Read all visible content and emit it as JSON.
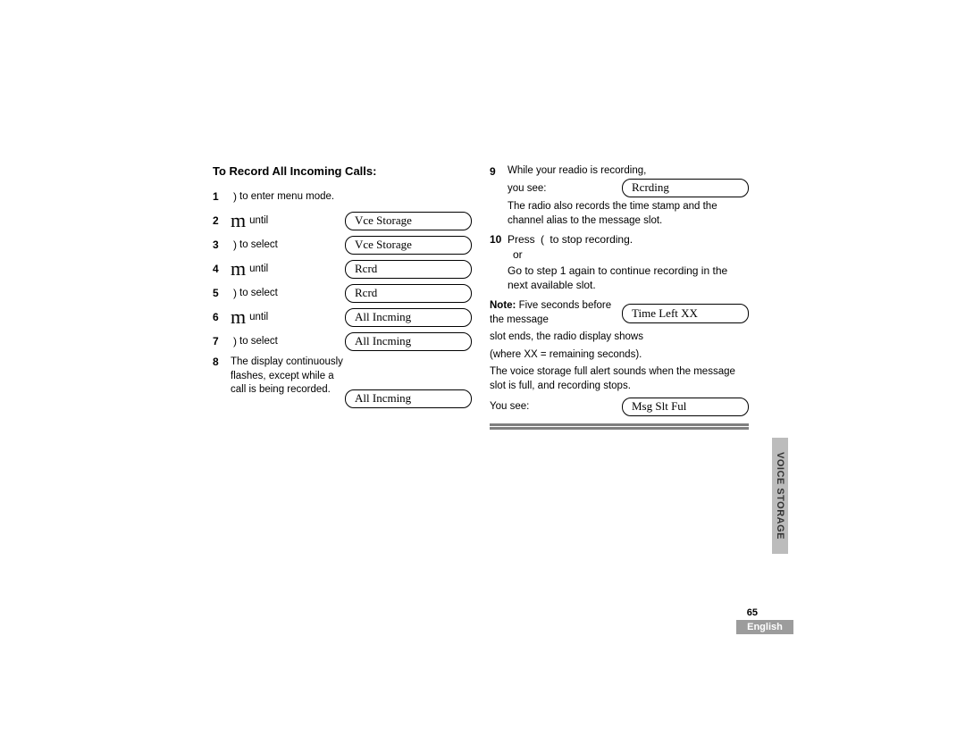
{
  "section_title": "To Record All Incoming Calls:",
  "left_steps": [
    {
      "n": "1",
      "icon": ")",
      "text": "to enter menu mode."
    },
    {
      "n": "2",
      "icon": "m",
      "text": "until",
      "lcd": "Vce Storage"
    },
    {
      "n": "3",
      "icon": ")",
      "text": "to select",
      "lcd": "Vce Storage"
    },
    {
      "n": "4",
      "icon": "m",
      "text": "until",
      "lcd": "Rcrd"
    },
    {
      "n": "5",
      "icon": ")",
      "text": "to select",
      "lcd": "Rcrd"
    },
    {
      "n": "6",
      "icon": "m",
      "text": "until",
      "lcd": "All Incming"
    },
    {
      "n": "7",
      "icon": ")",
      "text": "to select",
      "lcd": "All Incming"
    }
  ],
  "step8": {
    "n": "8",
    "text": "The display continuously flashes, except while a call is being recorded.",
    "lcd": "All Incming"
  },
  "right": {
    "step9_n": "9",
    "step9_a": "While your readio is recording,",
    "step9_b": "you see:",
    "step9_lcd": "Rcrding",
    "step9_c": "The radio also records the time stamp and the channel alias to the message slot.",
    "step10_n": "10",
    "step10_a": "Press",
    "step10_paren": "(",
    "step10_b": "to stop recording.",
    "step10_c": "or",
    "step10_d": "Go to step 1 again to continue recording in the next available slot.",
    "note_label": "Note:",
    "note_a": "Five seconds before the message",
    "note_lcd": "Time Left XX",
    "note_b": "slot ends, the radio display shows",
    "note_c": "(where XX = remaining seconds).",
    "full_a": "The  voice storage full alert sounds when the message slot is full, and recording stops.",
    "full_b": "You see:",
    "full_lcd": "Msg Slt Ful"
  },
  "sidebar": "VOICE STORAGE",
  "page_number": "65",
  "language": "English"
}
